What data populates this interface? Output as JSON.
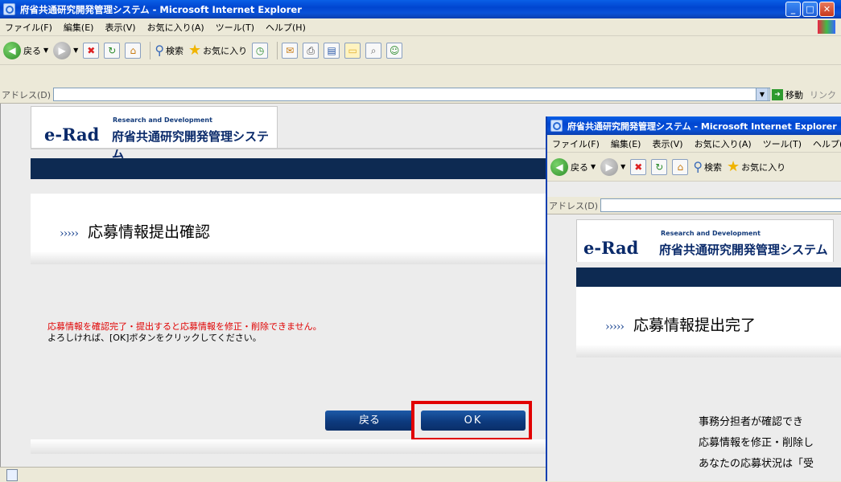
{
  "main_window": {
    "title": "府省共通研究開発管理システム - Microsoft Internet Explorer",
    "menu": [
      "ファイル(F)",
      "編集(E)",
      "表示(V)",
      "お気に入り(A)",
      "ツール(T)",
      "ヘルプ(H)"
    ],
    "toolbar": {
      "back": "戻る",
      "search": "検索",
      "favorites": "お気に入り"
    },
    "address_label": "アドレス(D)",
    "go_label": "移動",
    "links_label": "リンク"
  },
  "page": {
    "logo_sub": "Research and Development",
    "logo_mark": "e-Rad",
    "logo_name": "府省共通研究開発管理システム",
    "heading_arrows": "›››››",
    "heading": "応募情報提出確認",
    "warning": "応募情報を確認完了・提出すると応募情報を修正・削除できません。",
    "instruction": "よろしければ、[OK]ボタンをクリックしてください。",
    "back_button": "戻る",
    "ok_button": "OK"
  },
  "second_window": {
    "title": "府省共通研究開発管理システム - Microsoft Internet Explorer",
    "menu": [
      "ファイル(F)",
      "編集(E)",
      "表示(V)",
      "お気に入り(A)",
      "ツール(T)",
      "ヘルプ(H)"
    ],
    "toolbar": {
      "back": "戻る",
      "search": "検索",
      "favorites": "お気に入り"
    },
    "address_label": "アドレス(D)",
    "logo_sub": "Research and Development",
    "logo_mark": "e-Rad",
    "logo_name": "府省共通研究開発管理システム",
    "heading_arrows": "›››››",
    "heading": "応募情報提出完了",
    "lines": [
      "事務分担者が確認でき",
      "応募情報を修正・削除し",
      "あなたの応募状況は「受"
    ]
  },
  "colors": {
    "navy": "#0d2a52",
    "warning_red": "#e10000",
    "titlebar_blue": "#0a52d8"
  }
}
